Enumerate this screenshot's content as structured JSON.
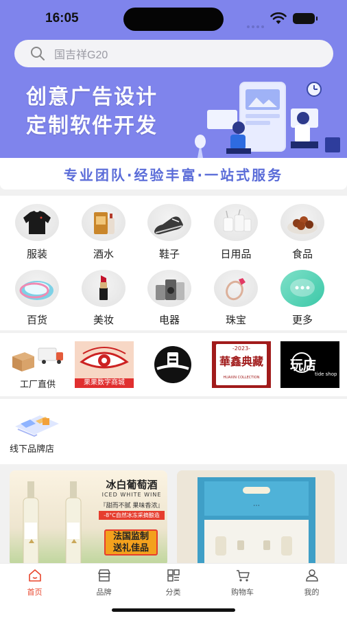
{
  "status_bar": {
    "time": "16:05"
  },
  "search": {
    "placeholder": "国吉祥G20"
  },
  "banner": {
    "line1": "创意广告设计",
    "line2": "定制软件开发",
    "tagline": "专业团队·经验丰富·一站式服务"
  },
  "categories": [
    {
      "label": "服装",
      "icon": "sweater-icon"
    },
    {
      "label": "酒水",
      "icon": "liquor-icon"
    },
    {
      "label": "鞋子",
      "icon": "shoe-icon"
    },
    {
      "label": "日用品",
      "icon": "daily-goods-icon"
    },
    {
      "label": "食品",
      "icon": "food-icon"
    },
    {
      "label": "百货",
      "icon": "basin-icon"
    },
    {
      "label": "美妆",
      "icon": "lipstick-icon"
    },
    {
      "label": "电器",
      "icon": "appliance-icon"
    },
    {
      "label": "珠宝",
      "icon": "ring-icon"
    },
    {
      "label": "更多",
      "icon": "more-chat-icon"
    }
  ],
  "brands": {
    "factory_label": "工厂直供",
    "logos": [
      {
        "name": "guoguo-logo",
        "text": "果果数字商城",
        "color": "#e02f2f"
      },
      {
        "name": "brand-circle-logo",
        "text": ""
      },
      {
        "name": "huaxin-logo",
        "text_main": "華鑫典藏",
        "text_year": "-2023-",
        "text_sub": "HUAXIN COLLECTION",
        "color": "#a11b1b"
      },
      {
        "name": "wandian-logo",
        "text_main": "玩店",
        "text_sub": "tide shop"
      }
    ]
  },
  "offline": {
    "label": "线下品牌店"
  },
  "products": [
    {
      "title": "冰白葡萄酒",
      "subtitle": "ICED WHITE WINE",
      "slogan": "『甜而不腻 果味香浓』",
      "note": "-8°C自然冰冻采摘酿造",
      "badge_line1": "法国监制",
      "badge_line2": "送礼佳品",
      "badge_color": "#e63d2e"
    },
    {
      "title": "",
      "box_color": "#3f9fc7"
    }
  ],
  "tabbar": [
    {
      "label": "首页",
      "icon": "home-icon",
      "active": true
    },
    {
      "label": "品牌",
      "icon": "store-icon",
      "active": false
    },
    {
      "label": "分类",
      "icon": "grid-icon",
      "active": false
    },
    {
      "label": "购物车",
      "icon": "cart-icon",
      "active": false
    },
    {
      "label": "我的",
      "icon": "user-icon",
      "active": false
    }
  ],
  "colors": {
    "hero_bg": "#7f84ec",
    "tagline": "#5a6cd8",
    "active_tab": "#e8452c"
  }
}
